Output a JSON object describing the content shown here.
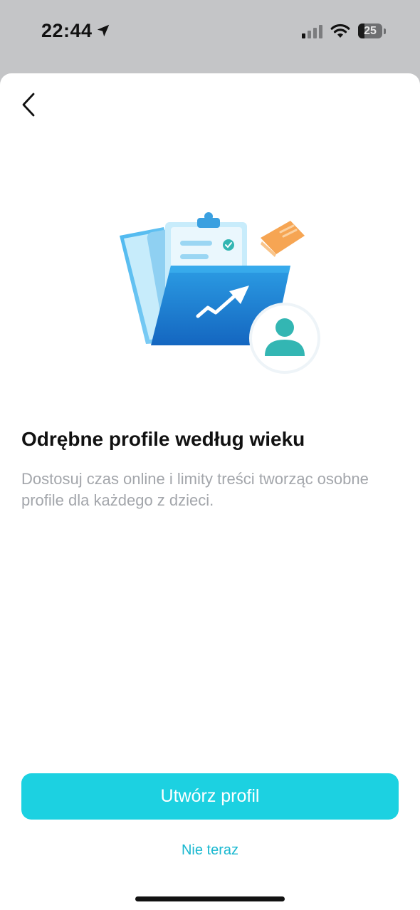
{
  "status_bar": {
    "time": "22:44",
    "battery_level": "25",
    "icons": [
      "location-arrow-icon",
      "cellular-signal-icon",
      "wifi-icon",
      "battery-icon"
    ]
  },
  "navigation": {
    "back_icon": "chevron-left-icon"
  },
  "illustration": {
    "icon": "folder-profile-illustration",
    "colors": {
      "folder": "#1f8ad8",
      "accent": "#33b6b3",
      "card": "#f6a553"
    }
  },
  "content": {
    "title": "Odrębne profile według wieku",
    "description": "Dostosuj czas online i limity treści tworząc osobne profile dla każdego z dzieci."
  },
  "actions": {
    "primary_label": "Utwórz profil",
    "secondary_label": "Nie teraz"
  },
  "colors": {
    "primary_button": "#1cd1e1",
    "secondary_link": "#19b8d0"
  }
}
